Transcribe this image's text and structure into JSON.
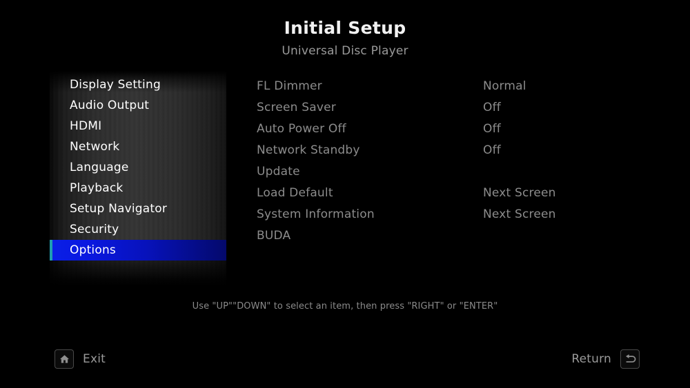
{
  "header": {
    "title": "Initial Setup",
    "subtitle": "Universal Disc Player"
  },
  "sidebar": {
    "items": [
      {
        "label": "Display Setting",
        "selected": false
      },
      {
        "label": "Audio Output",
        "selected": false
      },
      {
        "label": "HDMI",
        "selected": false
      },
      {
        "label": "Network",
        "selected": false
      },
      {
        "label": "Language",
        "selected": false
      },
      {
        "label": "Playback",
        "selected": false
      },
      {
        "label": "Setup Navigator",
        "selected": false
      },
      {
        "label": "Security",
        "selected": false
      },
      {
        "label": "Options",
        "selected": true
      }
    ]
  },
  "settings": {
    "rows": [
      {
        "name": "FL Dimmer",
        "value": "Normal"
      },
      {
        "name": "Screen Saver",
        "value": "Off"
      },
      {
        "name": "Auto Power Off",
        "value": "Off"
      },
      {
        "name": "Network Standby",
        "value": "Off"
      },
      {
        "name": "Update",
        "value": ""
      },
      {
        "name": "Load Default",
        "value": "Next Screen"
      },
      {
        "name": "System Information",
        "value": "Next Screen"
      },
      {
        "name": "BUDA",
        "value": ""
      }
    ]
  },
  "hint": {
    "text": "Use \"UP\"\"DOWN\" to select an item, then press \"RIGHT\" or \"ENTER\""
  },
  "footer": {
    "exit_label": "Exit",
    "exit_icon": "home-icon",
    "return_label": "Return",
    "return_icon": "return-arrow-icon"
  },
  "colors": {
    "background": "#000000",
    "highlight_blue": "#0a1fe6",
    "highlight_edge": "#1f9fb0",
    "menu_text": "#ffffff",
    "setting_text": "#8c8c8c"
  }
}
